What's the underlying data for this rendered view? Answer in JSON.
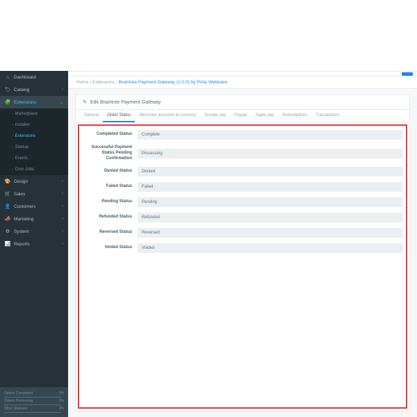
{
  "sidebar": {
    "items": [
      {
        "icon": "⌂",
        "label": "Dashboard",
        "chev": ""
      },
      {
        "icon": "🏷",
        "label": "Catalog",
        "chev": "›"
      },
      {
        "icon": "🧩",
        "label": "Extensions",
        "chev": "⌄",
        "active": true
      },
      {
        "icon": "🎨",
        "label": "Design",
        "chev": "›"
      },
      {
        "icon": "🛒",
        "label": "Sales",
        "chev": "›"
      },
      {
        "icon": "👤",
        "label": "Customers",
        "chev": "›"
      },
      {
        "icon": "📣",
        "label": "Marketing",
        "chev": "›"
      },
      {
        "icon": "⚙",
        "label": "System",
        "chev": "›"
      },
      {
        "icon": "📊",
        "label": "Reports",
        "chev": "›"
      }
    ],
    "sub": [
      {
        "label": "Marketplace"
      },
      {
        "label": "Installer"
      },
      {
        "label": "Extensions",
        "active": true
      },
      {
        "label": "Startup"
      },
      {
        "label": "Events"
      },
      {
        "label": "Cron Jobs"
      }
    ],
    "footer": {
      "r1_label": "Orders Completed",
      "r1_val": "0%",
      "r2_label": "Orders Processing",
      "r2_val": "0%",
      "r3_label": "Other Statuses",
      "r3_val": "0%"
    }
  },
  "breadcrumb": {
    "home": "Home",
    "ext": "Extensions",
    "page": "Braintree Payment Gateway (1.0.0) by Pinta Webware"
  },
  "panel": {
    "title": "Edit Braintree Payment Gateway"
  },
  "tabs": [
    {
      "label": "General"
    },
    {
      "label": "Order Status",
      "active": true
    },
    {
      "label": "Merchant accounts to currency"
    },
    {
      "label": "Google pay"
    },
    {
      "label": "Paypal"
    },
    {
      "label": "Apple pay"
    },
    {
      "label": "Subscriptions"
    },
    {
      "label": "Transactions"
    }
  ],
  "form": [
    {
      "label": "Completed Status",
      "value": "Complete"
    },
    {
      "label": "Successful Payment Status Pending Confirmation",
      "value": "Processing"
    },
    {
      "label": "Denied Status",
      "value": "Denied"
    },
    {
      "label": "Failed Status",
      "value": "Failed"
    },
    {
      "label": "Pending Status",
      "value": "Pending"
    },
    {
      "label": "Refunded Status",
      "value": "Refunded"
    },
    {
      "label": "Reversed Status",
      "value": "Reversed"
    },
    {
      "label": "Voided Status",
      "value": "Voided"
    }
  ]
}
